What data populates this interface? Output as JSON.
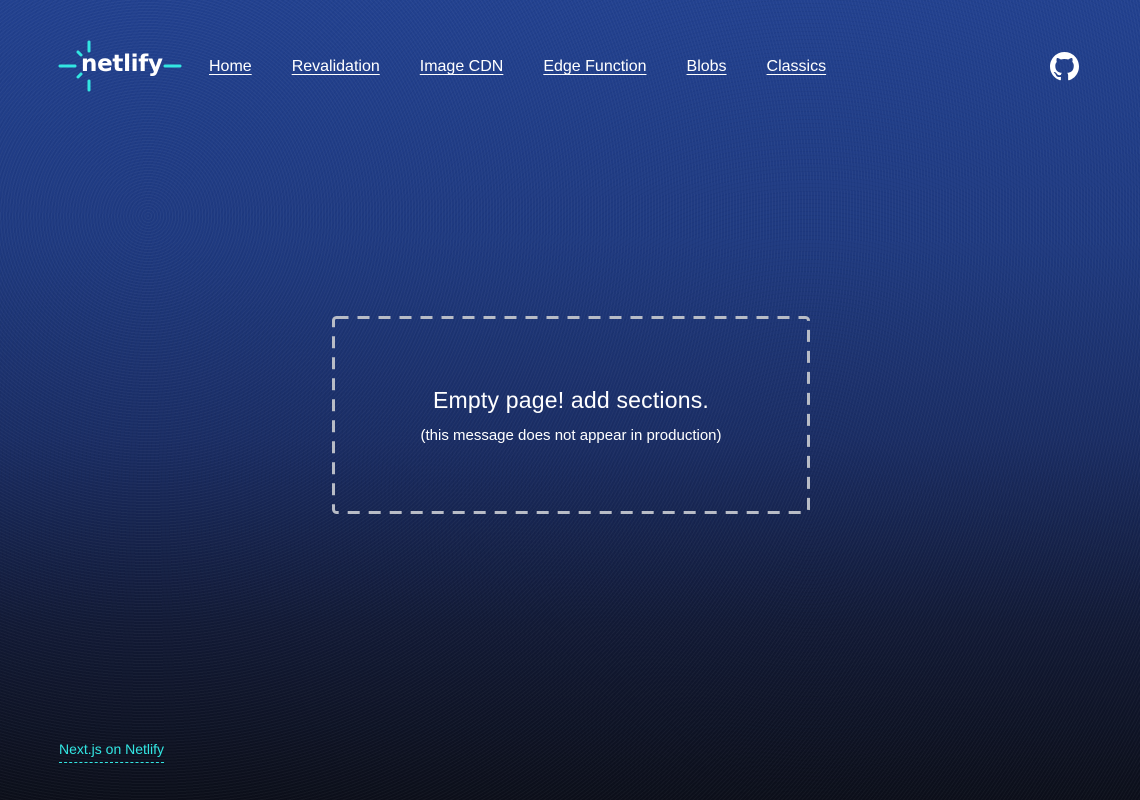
{
  "brand": {
    "logo_text": "netlify",
    "accent_color": "#32e6e2"
  },
  "nav": {
    "items": [
      {
        "label": "Home"
      },
      {
        "label": "Revalidation"
      },
      {
        "label": "Image CDN"
      },
      {
        "label": "Edge Function"
      },
      {
        "label": "Blobs"
      },
      {
        "label": "Classics"
      }
    ]
  },
  "github": {
    "icon": "github-icon"
  },
  "empty_state": {
    "title": "Empty page! add sections.",
    "subtitle": "(this message does not appear in production)",
    "border_color": "#b8bcc6"
  },
  "footer": {
    "link_label": "Next.js on Netlify"
  },
  "colors": {
    "background_top": "#22418f",
    "background_bottom": "#0c0f1a",
    "text": "#ffffff"
  }
}
